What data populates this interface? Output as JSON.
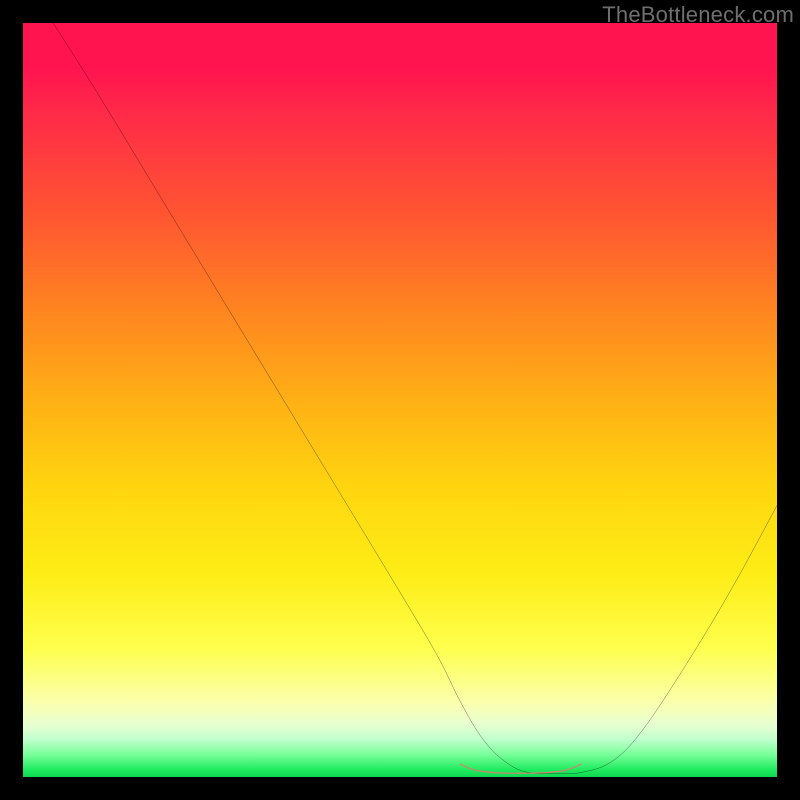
{
  "watermark": "TheBottleneck.com",
  "chart_data": {
    "type": "line",
    "title": "",
    "xlabel": "",
    "ylabel": "",
    "xlim": [
      0,
      100
    ],
    "ylim": [
      0,
      100
    ],
    "grid": false,
    "series": [
      {
        "name": "bottleneck-curve",
        "color": "#000000",
        "x": [
          4,
          10,
          20,
          30,
          40,
          50,
          55,
          58,
          61,
          64,
          67,
          71,
          74,
          78,
          82,
          88,
          94,
          100
        ],
        "y": [
          100,
          90.5,
          74,
          57.5,
          41,
          24.5,
          16,
          10,
          5,
          2,
          0.6,
          0.5,
          0.6,
          2,
          6,
          15,
          25,
          36
        ]
      },
      {
        "name": "optimal-segment",
        "color": "#e47a6f",
        "x": [
          58,
          60,
          63,
          66,
          69,
          72,
          74
        ],
        "y": [
          1.7,
          0.9,
          0.55,
          0.5,
          0.55,
          0.9,
          1.7
        ]
      }
    ],
    "background_gradient": {
      "top": "#ff1450",
      "upper_mid": "#ffb015",
      "lower_mid": "#feff4e",
      "bottom": "#0fd850"
    }
  }
}
